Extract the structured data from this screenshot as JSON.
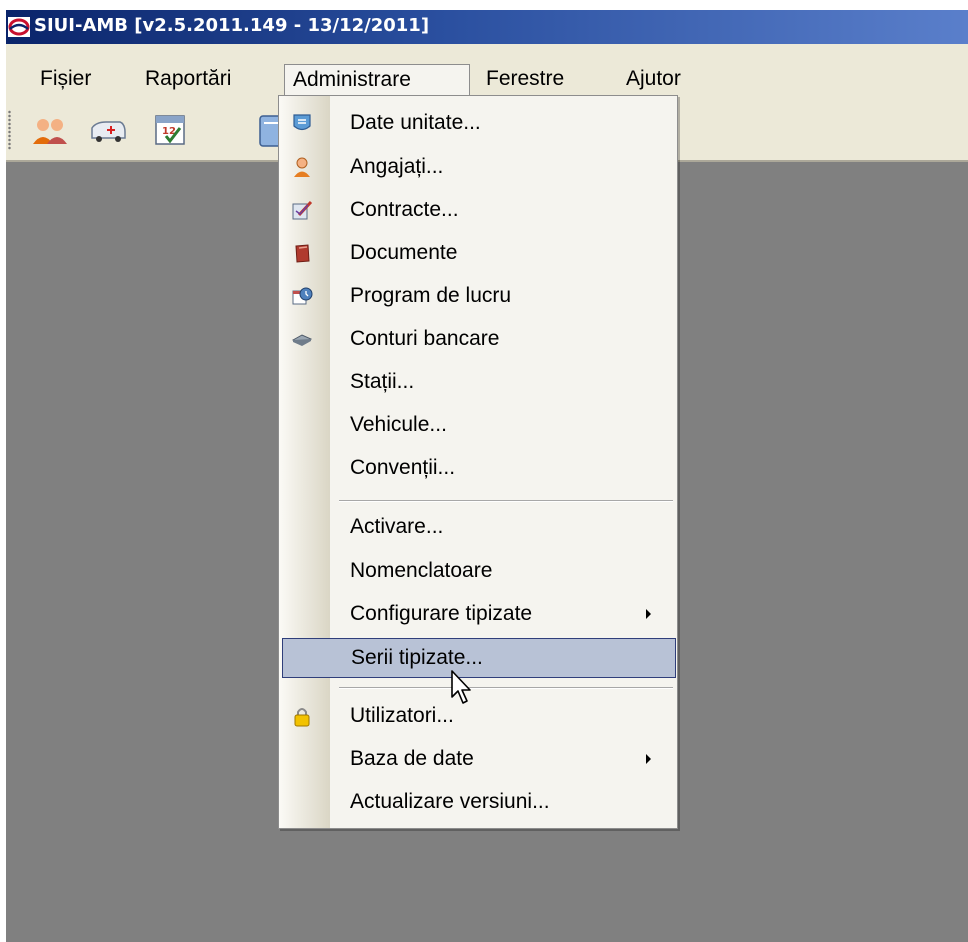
{
  "window": {
    "title": "SIUI-AMB [v2.5.2011.149 - 13/12/2011]",
    "icon": "app-logo-icon"
  },
  "menubar": {
    "items": [
      {
        "label": "Fișier"
      },
      {
        "label": "Raportări"
      },
      {
        "label": "Administrare",
        "open": true
      },
      {
        "label": "Ferestre"
      },
      {
        "label": "Ajutor"
      }
    ]
  },
  "toolbar": {
    "buttons": [
      {
        "icon": "users-icon"
      },
      {
        "icon": "ambulance-icon"
      },
      {
        "icon": "calendar-icon"
      },
      {
        "icon": "document-icon"
      }
    ]
  },
  "dropdown": {
    "items": [
      {
        "label": "Date unitate...",
        "icon": "unit-data-icon"
      },
      {
        "label": "Angajați...",
        "icon": "employee-icon"
      },
      {
        "label": "Contracte...",
        "icon": "contract-icon"
      },
      {
        "label": "Documente",
        "icon": "documents-icon"
      },
      {
        "label": "Program de lucru",
        "icon": "work-schedule-icon"
      },
      {
        "label": "Conturi bancare",
        "icon": "bank-accounts-icon"
      },
      {
        "label": "Stații..."
      },
      {
        "label": "Vehicule..."
      },
      {
        "label": "Convenții..."
      },
      {
        "label": "Activare..."
      },
      {
        "label": "Nomenclatoare"
      },
      {
        "label": "Configurare tipizate",
        "submenu": true
      },
      {
        "label": "Serii tipizate...",
        "highlighted": true
      },
      {
        "label": "Utilizatori...",
        "icon": "lock-icon"
      },
      {
        "label": "Baza de date",
        "submenu": true
      },
      {
        "label": "Actualizare versiuni..."
      }
    ]
  },
  "colors": {
    "titlebar_start": "#0a246a",
    "titlebar_end": "#5a7fcb",
    "menubar_bg": "#ece9d8",
    "client_bg": "#808080",
    "highlight_bg": "#b8c2d6",
    "highlight_border": "#2f3e7a"
  }
}
